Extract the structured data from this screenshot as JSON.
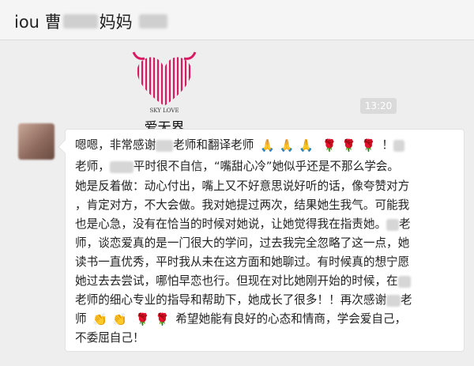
{
  "header": {
    "prefix": "iou 曹",
    "middle": "妈妈"
  },
  "logo": {
    "brand_en": "SKY LOVE",
    "brand_cn": "爱无界",
    "color": "#d81b60"
  },
  "timestamp": "13:20",
  "message": {
    "line1": {
      "a": "嗯嗯，非常感谢",
      "b": "老师和翻译老师",
      "end": "！"
    },
    "line2": {
      "a": "老师，",
      "b": "平时很不自信，“嘴甜心冷”她似乎还是不那么学会。"
    },
    "line3": "她是反着做：动心付出，嘴上又不好意思说好听的话，像夸赞对方",
    "line4": "，肯定对方，不大会做。我对她提过两次，结果她生我气。可能我",
    "line5": {
      "a": "也是心急，没有在恰当的时候对她说，让她觉得我在指责她。",
      "b": "老"
    },
    "line6": "师，谈恋爱真的是一门很大的学问，过去我完全忽略了这一点，她",
    "line7": "读书一直优秀，平时我从未在这方面和她聊过。有时候真的想宁愿",
    "line8": "她过去去尝试，哪怕早恋也行。但现在对比她刚开始的时候，在",
    "line9": {
      "a": "老师的细心专业的指导和帮助下，她成长了很多！！再次感谢",
      "b": "老"
    },
    "line10": {
      "a": "师",
      "b": "希望她能有良好的心态和情商，学会爱自己，"
    },
    "line11": "不委屈自己！"
  },
  "emoji": {
    "pray": "🙏",
    "rose": "🌹",
    "clap": "👏"
  }
}
